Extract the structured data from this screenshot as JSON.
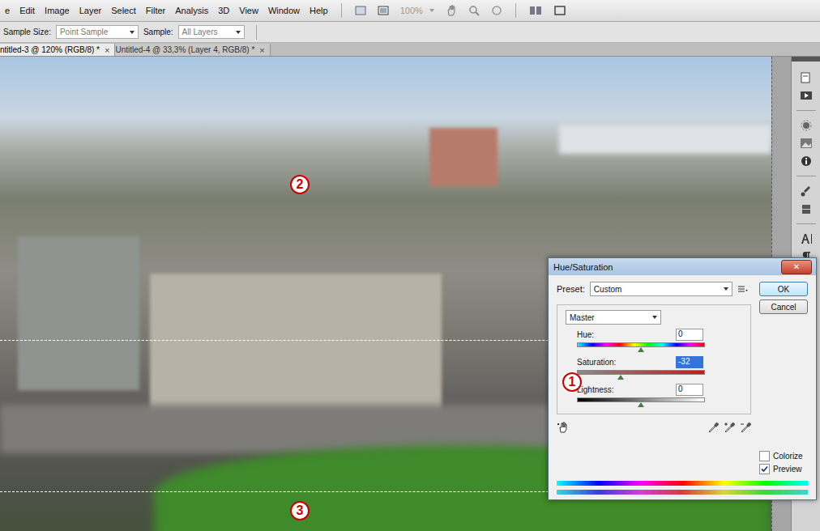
{
  "menu": [
    "e",
    "Edit",
    "Image",
    "Layer",
    "Select",
    "Filter",
    "Analysis",
    "3D",
    "View",
    "Window",
    "Help"
  ],
  "zoom": "100%",
  "options": {
    "sample_size_label": "Sample Size:",
    "sample_size": "Point Sample",
    "sample_label": "Sample:",
    "sample": "All Layers"
  },
  "tabs": [
    {
      "label": "ntitled-3 @ 120% (RGB/8) *",
      "selected": true,
      "close": "×"
    },
    {
      "label": "Untitled-4 @ 33,3% (Layer 4, RGB/8) *",
      "selected": false,
      "close": "×"
    }
  ],
  "dialog": {
    "title": "Hue/Saturation",
    "close": "✕",
    "preset_label": "Preset:",
    "preset": "Custom",
    "channel": "Master",
    "sliders": [
      {
        "label": "Hue:",
        "value": "0",
        "level": 0.5,
        "selected": false,
        "kind": "hue"
      },
      {
        "label": "Saturation:",
        "value": "-32",
        "level": 0.34,
        "selected": true,
        "kind": "saturation"
      },
      {
        "label": "Lightness:",
        "value": "0",
        "level": 0.5,
        "selected": false,
        "kind": "lightness"
      }
    ],
    "buttons": [
      "OK",
      "Cancel"
    ],
    "checkboxes": [
      {
        "label": "Colorize",
        "checked": false
      },
      {
        "label": "Preview",
        "checked": true
      }
    ]
  },
  "markers": [
    {
      "label": "1"
    },
    {
      "label": "2"
    },
    {
      "label": "3"
    }
  ]
}
